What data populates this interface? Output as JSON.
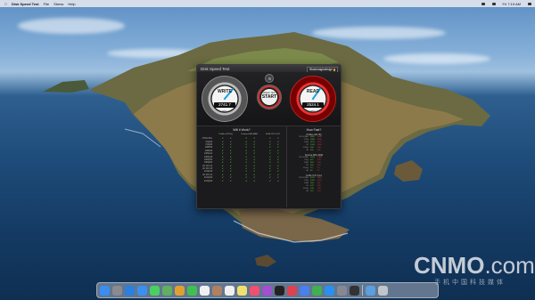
{
  "menubar": {
    "app_name": "Disk Speed Test",
    "items": [
      "File",
      "Stress",
      "Help"
    ],
    "clock": "Fri 7:19 AM"
  },
  "window": {
    "title": "Disk Speed Test",
    "brand": "Blackmagicdesign",
    "write": {
      "label": "WRITE",
      "value": "2741.7",
      "unit": "MB/s"
    },
    "read": {
      "label": "READ",
      "value": "2524.1",
      "unit": "MB/s"
    },
    "start": {
      "sub": "SPEED TEST",
      "label": "START"
    },
    "will_it_work": {
      "title": "Will it Work?",
      "groups": [
        "ProRes 422 HQ",
        "Cinema DNG RAW",
        "10-Bit YUV 4:2:2"
      ],
      "subheaders": [
        "Write",
        "Read"
      ],
      "rows": [
        "NTSC/PAL",
        "720p50",
        "720p60",
        "1080i50",
        "1080i60",
        "1080p24",
        "1080p30",
        "1080p50",
        "1080p60",
        "2K DCI 24",
        "2K DCI 25",
        "2160p30",
        "4K DCI 24",
        "2160p50",
        "2160p60"
      ],
      "mark": "✔"
    },
    "how_fast": {
      "title": "How Fast?",
      "groups": [
        {
          "name": "ProRes 422 HQ",
          "rows": [
            [
              "NTSC/PAL",
              "6892",
              "6892"
            ],
            [
              "720p",
              "2836",
              "2836"
            ],
            [
              "1080",
              "1137",
              "1137"
            ],
            [
              "2K",
              "1024",
              "1024"
            ],
            [
              "2160p",
              "284",
              "284"
            ],
            [
              "4K",
              "261",
              "261"
            ]
          ]
        },
        {
          "name": "Cinema DNG RAW",
          "rows": [
            [
              "NTSC/PAL",
              "1613",
              "1486"
            ],
            [
              "720p",
              "627",
              "578"
            ],
            [
              "1080",
              "318",
              "293"
            ],
            [
              "2K",
              "251",
              "231"
            ],
            [
              "2160p",
              "79",
              "73"
            ],
            [
              "4K",
              "62",
              "57"
            ]
          ]
        },
        {
          "name": "10-Bit YUV 4:2:2",
          "rows": [
            [
              "NTSC/PAL",
              "4215",
              "3881"
            ],
            [
              "720p",
              "1311",
              "1207"
            ],
            [
              "1080",
              "583",
              "537"
            ],
            [
              "2K",
              "479",
              "441"
            ],
            [
              "2160p",
              "145",
              "134"
            ],
            [
              "4K",
              "119",
              "110"
            ]
          ]
        }
      ]
    }
  },
  "watermark": {
    "brand": "CNMO",
    "suffix": ".com",
    "sub": "手机中国科技媒体"
  },
  "dock": {
    "icons": [
      "finder-icon",
      "launchpad-icon",
      "safari-icon",
      "mail-icon",
      "messages-icon",
      "maps-icon",
      "photos-icon",
      "facetime-icon",
      "calendar-icon",
      "contacts-icon",
      "reminders-icon",
      "notes-icon",
      "music-icon",
      "podcasts-icon",
      "tv-icon",
      "news-icon",
      "keynote-icon",
      "numbers-icon",
      "appstore-icon",
      "preferences-icon",
      "blackmagic-icon",
      "downloads-icon",
      "trash-icon"
    ],
    "colors": [
      "#3a8ef0",
      "#8a8a8f",
      "#2a7fe0",
      "#3a90f0",
      "#4ad060",
      "#60b060",
      "#e0a030",
      "#40c050",
      "#f0f0f0",
      "#b08060",
      "#f0f0f0",
      "#f0e070",
      "#f05070",
      "#a050d0",
      "#222222",
      "#e04050",
      "#4a7ff0",
      "#40b050",
      "#2a90f0",
      "#888890",
      "#333333",
      "#5aa0e0",
      "#c0c4cc"
    ]
  }
}
